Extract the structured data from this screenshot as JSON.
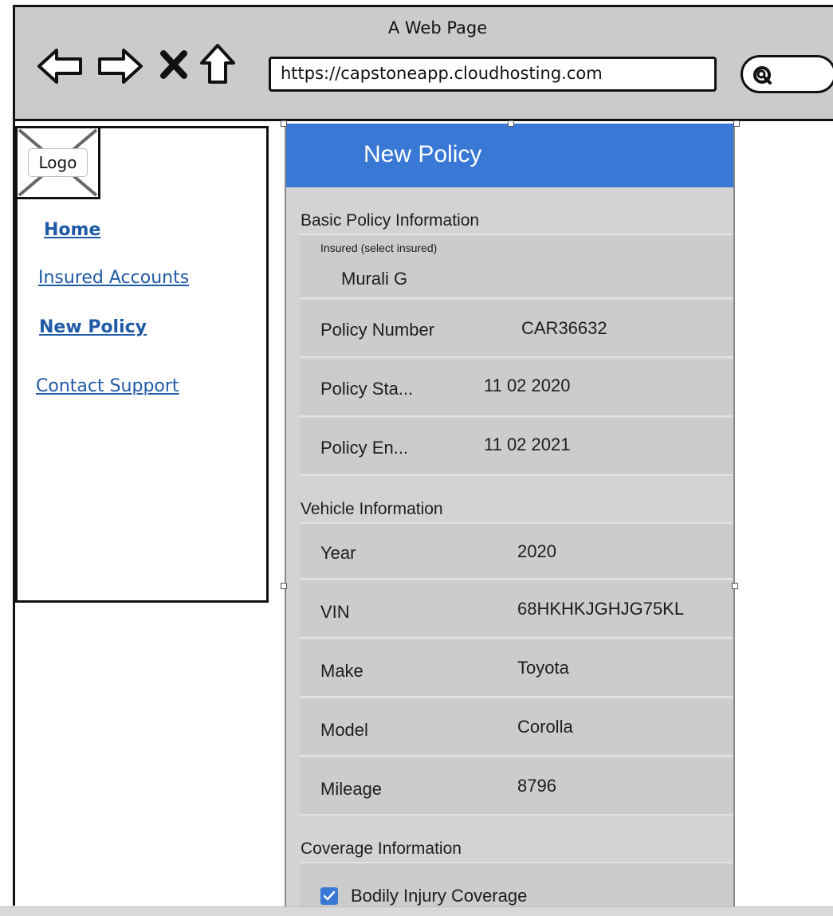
{
  "browser": {
    "title": "A Web Page",
    "url": "https://capstoneapp.cloudhosting.com"
  },
  "sidebar": {
    "logo": "Logo",
    "links": [
      {
        "label": "Home",
        "bold": true
      },
      {
        "label": "Insured Accounts",
        "bold": false
      },
      {
        "label": "New Policy",
        "bold": true
      },
      {
        "label": "Contact Support",
        "bold": false
      }
    ]
  },
  "panel": {
    "header": "New Policy",
    "basic": {
      "heading": "Basic Policy Information",
      "insured_label": "Insured (select insured)",
      "insured_value": "Murali G",
      "policy_number_label": "Policy Number",
      "policy_number_value": "CAR36632",
      "start_label": "Policy Sta...",
      "start_value": "11 02 2020",
      "end_label": "Policy En...",
      "end_value": "11 02 2021"
    },
    "vehicle": {
      "heading": "Vehicle Information",
      "year_label": "Year",
      "year_value": "2020",
      "vin_label": "VIN",
      "vin_value": "68HKHKJGHJG75KL",
      "make_label": "Make",
      "make_value": "Toyota",
      "model_label": "Model",
      "model_value": "Corolla",
      "mileage_label": "Mileage",
      "mileage_value": "8796"
    },
    "coverage": {
      "heading": "Coverage Information",
      "bodily_label": "Bodily Injury Coverage",
      "bodily_checked": true
    }
  },
  "colors": {
    "header_blue": "#3a78d6",
    "link_blue": "#1f5aa6",
    "panel_gray": "#d3d3d3"
  }
}
